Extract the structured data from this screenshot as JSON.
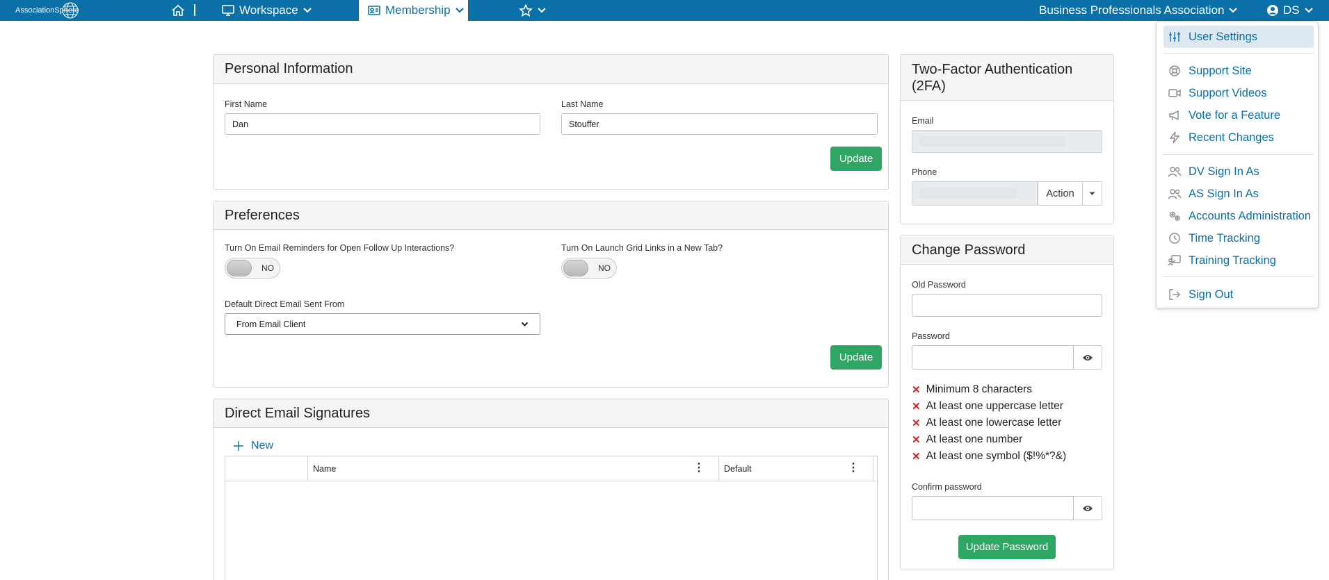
{
  "topnav": {
    "logo_text_1": "Association",
    "logo_text_2": "Sphere",
    "workspace": "Workspace",
    "membership": "Membership",
    "association": "Business Professionals Association",
    "user_initials": "DS"
  },
  "personal": {
    "title": "Personal Information",
    "first_name_label": "First Name",
    "first_name_value": "Dan",
    "last_name_label": "Last Name",
    "last_name_value": "Stouffer",
    "update_label": "Update"
  },
  "preferences": {
    "title": "Preferences",
    "email_reminders_label": "Turn On Email Reminders for Open Follow Up Interactions?",
    "email_reminders_state": "NO",
    "grid_links_label": "Turn On Launch Grid Links in a New Tab?",
    "grid_links_state": "NO",
    "direct_email_label": "Default Direct Email Sent From",
    "direct_email_value": "From Email Client",
    "update_label": "Update"
  },
  "signatures": {
    "title": "Direct Email Signatures",
    "new_label": "New",
    "columns": [
      "Name",
      "Default"
    ]
  },
  "twofa": {
    "title_line1": "Two-Factor Authentication",
    "title_line2": "(2FA)",
    "email_label": "Email",
    "phone_label": "Phone",
    "action_label": "Action"
  },
  "password": {
    "title": "Change Password",
    "old_label": "Old Password",
    "new_label": "Password",
    "rules": [
      "Minimum 8 characters",
      "At least one uppercase letter",
      "At least one lowercase letter",
      "At least one number",
      "At least one symbol ($!%*?&)"
    ],
    "confirm_label": "Confirm password",
    "update_label": "Update Password"
  },
  "user_menu": {
    "items": [
      "User Settings",
      "Support Site",
      "Support Videos",
      "Vote for a Feature",
      "Recent Changes",
      "DV Sign In As",
      "AS Sign In As",
      "Accounts Administration",
      "Time Tracking",
      "Training Tracking",
      "Sign Out"
    ]
  },
  "colors": {
    "brand": "#0b6fa8",
    "success": "#2fa664",
    "error": "#c62828"
  }
}
